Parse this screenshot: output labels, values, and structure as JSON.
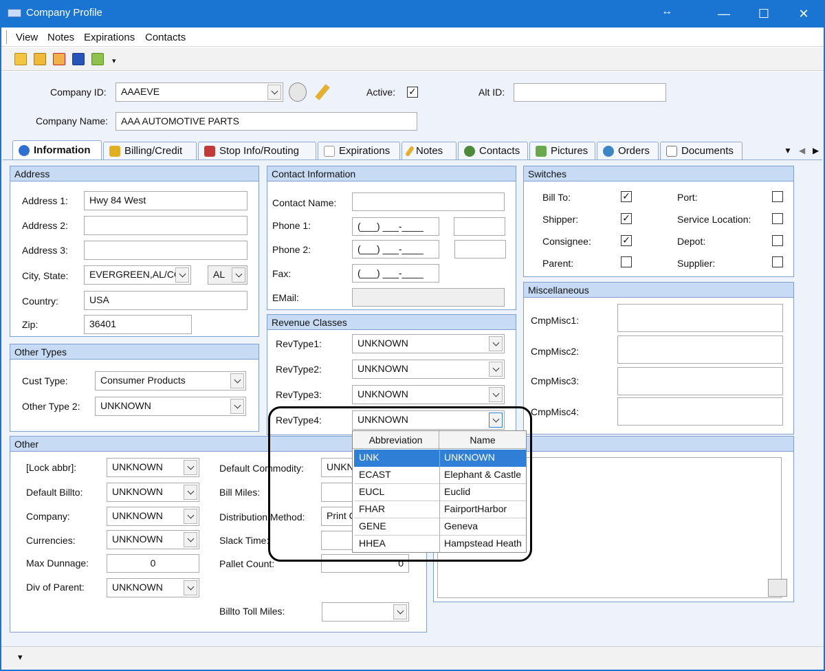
{
  "window": {
    "title": "Company Profile",
    "resize_glyph": "↔",
    "min": "—",
    "max": "☐",
    "close": "✕"
  },
  "menu": [
    "View",
    "Notes",
    "Expirations",
    "Contacts"
  ],
  "toolbar": [
    "new-icon",
    "open-icon",
    "delete-icon",
    "save-icon",
    "export-icon"
  ],
  "header": {
    "company_id_label": "Company ID:",
    "company_id": "AAAEVE",
    "active_label": "Active:",
    "active_check": "✓",
    "alt_id_label": "Alt ID:",
    "alt_id": "",
    "company_name_label": "Company Name:",
    "company_name": "AAA AUTOMOTIVE PARTS"
  },
  "tabs": [
    "Information",
    "Billing/Credit",
    "Stop Info/Routing",
    "Expirations",
    "Notes",
    "Contacts",
    "Pictures",
    "Orders",
    "Documents"
  ],
  "address": {
    "title": "Address",
    "a1_label": "Address 1:",
    "a1": "Hwy 84 West",
    "a2_label": "Address 2:",
    "a2": "",
    "a3_label": "Address 3:",
    "a3": "",
    "city_label": "City, State:",
    "city": "EVERGREEN,AL/CO",
    "state": "AL",
    "country_label": "Country:",
    "country": "USA",
    "zip_label": "Zip:",
    "zip": "36401"
  },
  "contact": {
    "title": "Contact Information",
    "name_label": "Contact Name:",
    "phone1_label": "Phone 1:",
    "phone_mask": "(___) ___-____",
    "phone2_label": "Phone 2:",
    "fax_label": "Fax:",
    "email_label": "EMail:"
  },
  "switches": {
    "title": "Switches",
    "items": [
      {
        "label": "Bill To:",
        "check": "✓"
      },
      {
        "label": "Port:",
        "check": ""
      },
      {
        "label": "Shipper:",
        "check": "✓"
      },
      {
        "label": "Service Location:",
        "check": ""
      },
      {
        "label": "Consignee:",
        "check": "✓"
      },
      {
        "label": "Depot:",
        "check": ""
      },
      {
        "label": "Parent:",
        "check": ""
      },
      {
        "label": "Supplier:",
        "check": ""
      }
    ]
  },
  "misc": {
    "title": "Miscellaneous",
    "items": [
      "CmpMisc1:",
      "CmpMisc2:",
      "CmpMisc3:",
      "CmpMisc4:"
    ]
  },
  "revenue": {
    "title": "Revenue Classes",
    "items": [
      {
        "label": "RevType1:",
        "value": "UNKNOWN"
      },
      {
        "label": "RevType2:",
        "value": "UNKNOWN"
      },
      {
        "label": "RevType3:",
        "value": "UNKNOWN"
      },
      {
        "label": "RevType4:",
        "value": "UNKNOWN"
      }
    ]
  },
  "other_types": {
    "title": "Other Types",
    "cust_label": "Cust Type:",
    "cust": "Consumer Products",
    "other2_label": "Other Type 2:",
    "other2": "UNKNOWN"
  },
  "other": {
    "title": "Other",
    "lock_label": "[Lock abbr]:",
    "lock": "UNKNOWN",
    "billto_label": "Default Billto:",
    "billto": "UNKNOWN",
    "company_label": "Company:",
    "company": "UNKNOWN",
    "currencies_label": "Currencies:",
    "currencies": "UNKNOWN",
    "dunnage_label": "Max Dunnage:",
    "dunnage": "0",
    "div_label": "Div of Parent:",
    "div": "UNKNOWN",
    "commodity_label": "Default Commodity:",
    "commodity": "UNKN",
    "billmiles_label": "Bill Miles:",
    "dist_label": "Distribution Method:",
    "dist": "Print C",
    "slack_label": "Slack Time:",
    "pallet_label": "Pallet Count:",
    "pallet": "0",
    "toll_label": "Billto Toll Miles:"
  },
  "dropdown": {
    "col_abbr": "Abbreviation",
    "col_name": "Name",
    "rows": [
      {
        "abbr": "UNK",
        "name": "UNKNOWN"
      },
      {
        "abbr": "ECAST",
        "name": "Elephant & Castle"
      },
      {
        "abbr": "EUCL",
        "name": "Euclid"
      },
      {
        "abbr": "FHAR",
        "name": "FairportHarbor"
      },
      {
        "abbr": "GENE",
        "name": "Geneva"
      },
      {
        "abbr": "HHEA",
        "name": "Hampstead Heath"
      }
    ]
  },
  "status": {
    "arrow": "▾"
  }
}
